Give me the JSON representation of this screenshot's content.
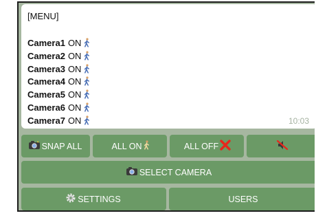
{
  "message": {
    "title": "[MENU]",
    "cameras": [
      {
        "name": "Camera1",
        "state": "ON"
      },
      {
        "name": "Camera2",
        "state": "ON"
      },
      {
        "name": "Camera3",
        "state": "ON"
      },
      {
        "name": "Camera4",
        "state": "ON"
      },
      {
        "name": "Camera5",
        "state": "ON"
      },
      {
        "name": "Camera6",
        "state": "ON"
      },
      {
        "name": "Camera7",
        "state": "ON"
      }
    ],
    "time": "10:03",
    "camera_icon": "walking-person-icon"
  },
  "keyboard": {
    "row1": {
      "snap_all": "SNAP ALL",
      "all_on": "ALL ON",
      "all_off": "ALL OFF",
      "mute_icon": "muted-speaker-icon"
    },
    "row2": {
      "select_camera": "SELECT CAMERA"
    },
    "row3": {
      "settings": "SETTINGS",
      "users": "USERS"
    }
  },
  "colors": {
    "button_bg": "#6b9a66",
    "chat_bg": "#a6b7a0",
    "timestamp": "#a5b2a1",
    "off_cross": "#e8271c"
  }
}
